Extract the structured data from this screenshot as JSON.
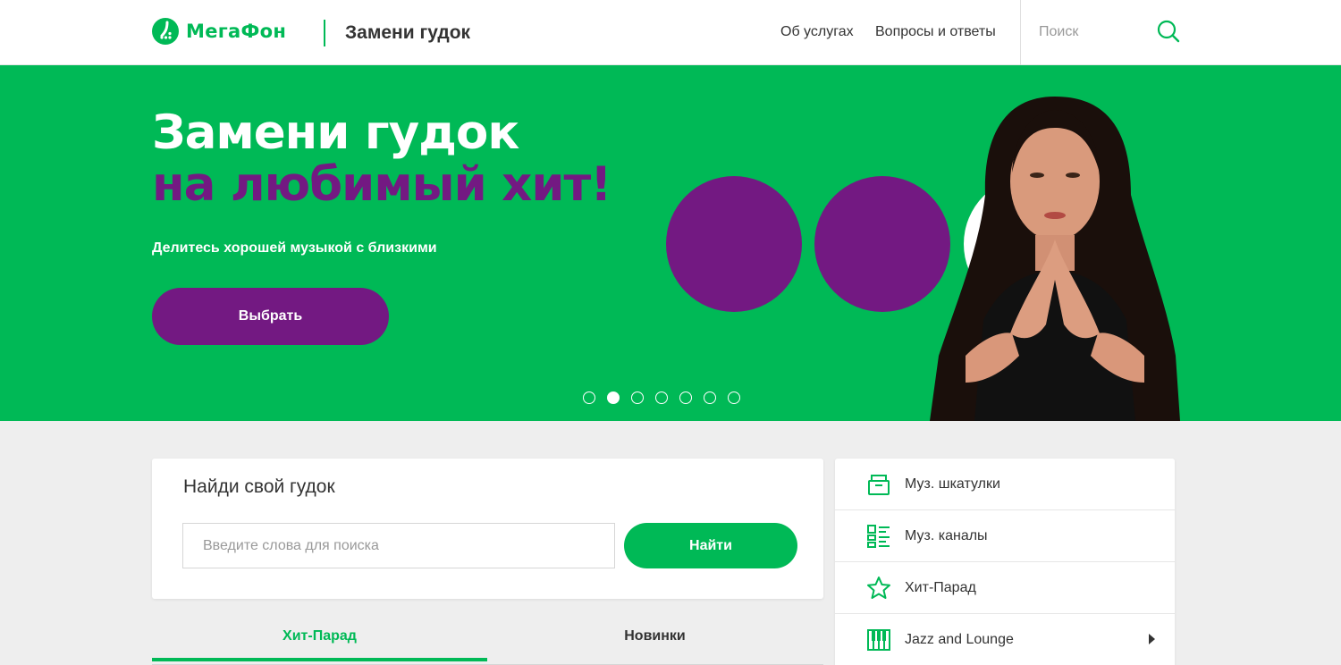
{
  "header": {
    "logo_text": "МегаФон",
    "service_title": "Замени гудок",
    "nav": [
      "Об услугах",
      "Вопросы и ответы"
    ],
    "search_placeholder": "Поиск"
  },
  "hero": {
    "title_line1": "Замени гудок",
    "title_line2": "на любимый хит!",
    "subtitle": "Делитесь хорошей музыкой с близкими",
    "button_label": "Выбрать",
    "slide_count": 7,
    "active_slide": 2
  },
  "search_card": {
    "title": "Найди свой гудок",
    "input_placeholder": "Введите слова для поиска",
    "button_label": "Найти"
  },
  "tabs": [
    {
      "label": "Хит-Парад",
      "active": true
    },
    {
      "label": "Новинки",
      "active": false
    }
  ],
  "sidebar": {
    "items": [
      {
        "label": "Муз. шкатулки",
        "icon": "music-box-icon"
      },
      {
        "label": "Муз. каналы",
        "icon": "channels-icon"
      },
      {
        "label": "Хит-Парад",
        "icon": "star-icon"
      },
      {
        "label": "Jazz and Lounge",
        "icon": "piano-icon",
        "has_arrow": true
      }
    ]
  },
  "colors": {
    "brand_green": "#00b956",
    "brand_purple": "#731982",
    "white": "#ffffff",
    "background": "#eeeeee"
  }
}
